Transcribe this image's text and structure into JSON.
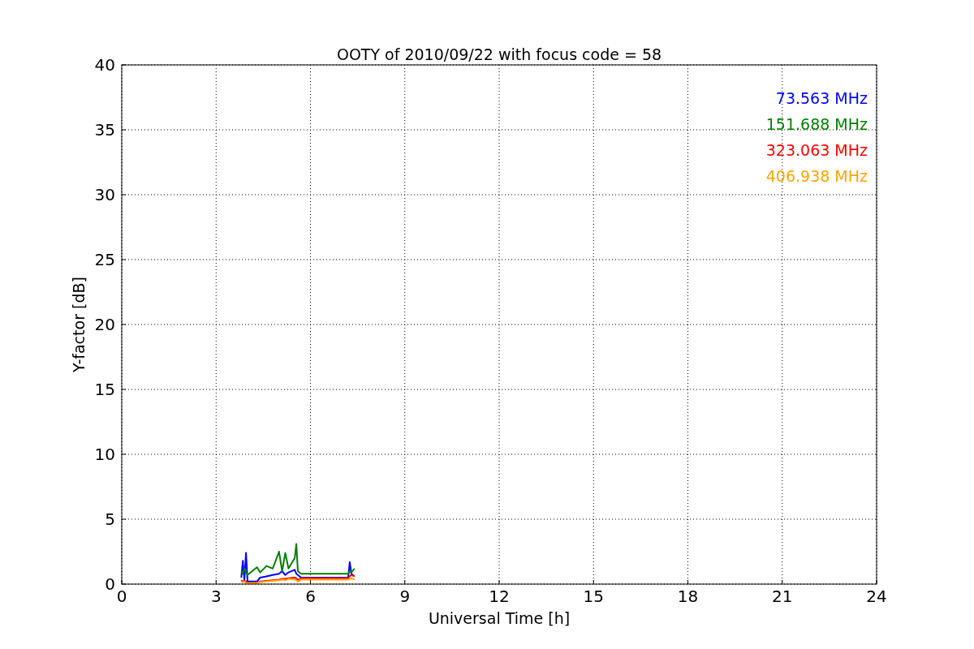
{
  "figure": {
    "chart_data": {
      "type": "line",
      "title": "OOTY of 2010/09/22 with focus code = 58",
      "xlabel": "Universal Time [h]",
      "ylabel": "Y-factor [dB]",
      "xlim": [
        0,
        24
      ],
      "ylim": [
        0,
        40
      ],
      "xticks": [
        0,
        3,
        6,
        9,
        12,
        15,
        18,
        21,
        24
      ],
      "yticks": [
        0,
        5,
        10,
        15,
        20,
        25,
        30,
        35,
        40
      ],
      "grid": true,
      "x": [
        3.8,
        3.85,
        3.9,
        3.95,
        4.0,
        4.3,
        4.4,
        4.6,
        4.8,
        5.0,
        5.1,
        5.2,
        5.3,
        5.5,
        5.55,
        5.6,
        5.7,
        7.2,
        7.25,
        7.3,
        7.4
      ],
      "series": [
        {
          "name": "73.563 MHz",
          "color": "#0000ff",
          "values": [
            0.5,
            1.8,
            0.3,
            2.4,
            0.2,
            0.2,
            0.5,
            0.6,
            0.7,
            0.8,
            1.0,
            0.7,
            0.9,
            1.1,
            0.8,
            0.7,
            0.5,
            0.5,
            1.7,
            0.8,
            0.6
          ]
        },
        {
          "name": "151.688 MHz",
          "color": "#008000",
          "values": [
            1.0,
            0.8,
            1.2,
            0.9,
            0.7,
            1.3,
            0.9,
            1.4,
            1.2,
            2.5,
            1.0,
            2.4,
            1.2,
            2.0,
            3.1,
            1.0,
            0.8,
            0.8,
            1.0,
            0.9,
            1.2
          ]
        },
        {
          "name": "323.063 MHz",
          "color": "#ff0000",
          "values": [
            0.3,
            0.2,
            0.25,
            0.2,
            0.1,
            0.1,
            0.2,
            0.25,
            0.3,
            0.35,
            0.4,
            0.4,
            0.45,
            0.5,
            0.45,
            0.3,
            0.45,
            0.45,
            0.6,
            0.7,
            0.6
          ]
        },
        {
          "name": "406.938 MHz",
          "color": "#ffa500",
          "values": [
            0.2,
            0.15,
            0.2,
            0.1,
            0.05,
            0.1,
            0.15,
            0.2,
            0.25,
            0.3,
            0.35,
            0.3,
            0.4,
            0.35,
            0.3,
            0.2,
            0.35,
            0.35,
            0.4,
            0.45,
            0.35
          ]
        }
      ]
    }
  }
}
